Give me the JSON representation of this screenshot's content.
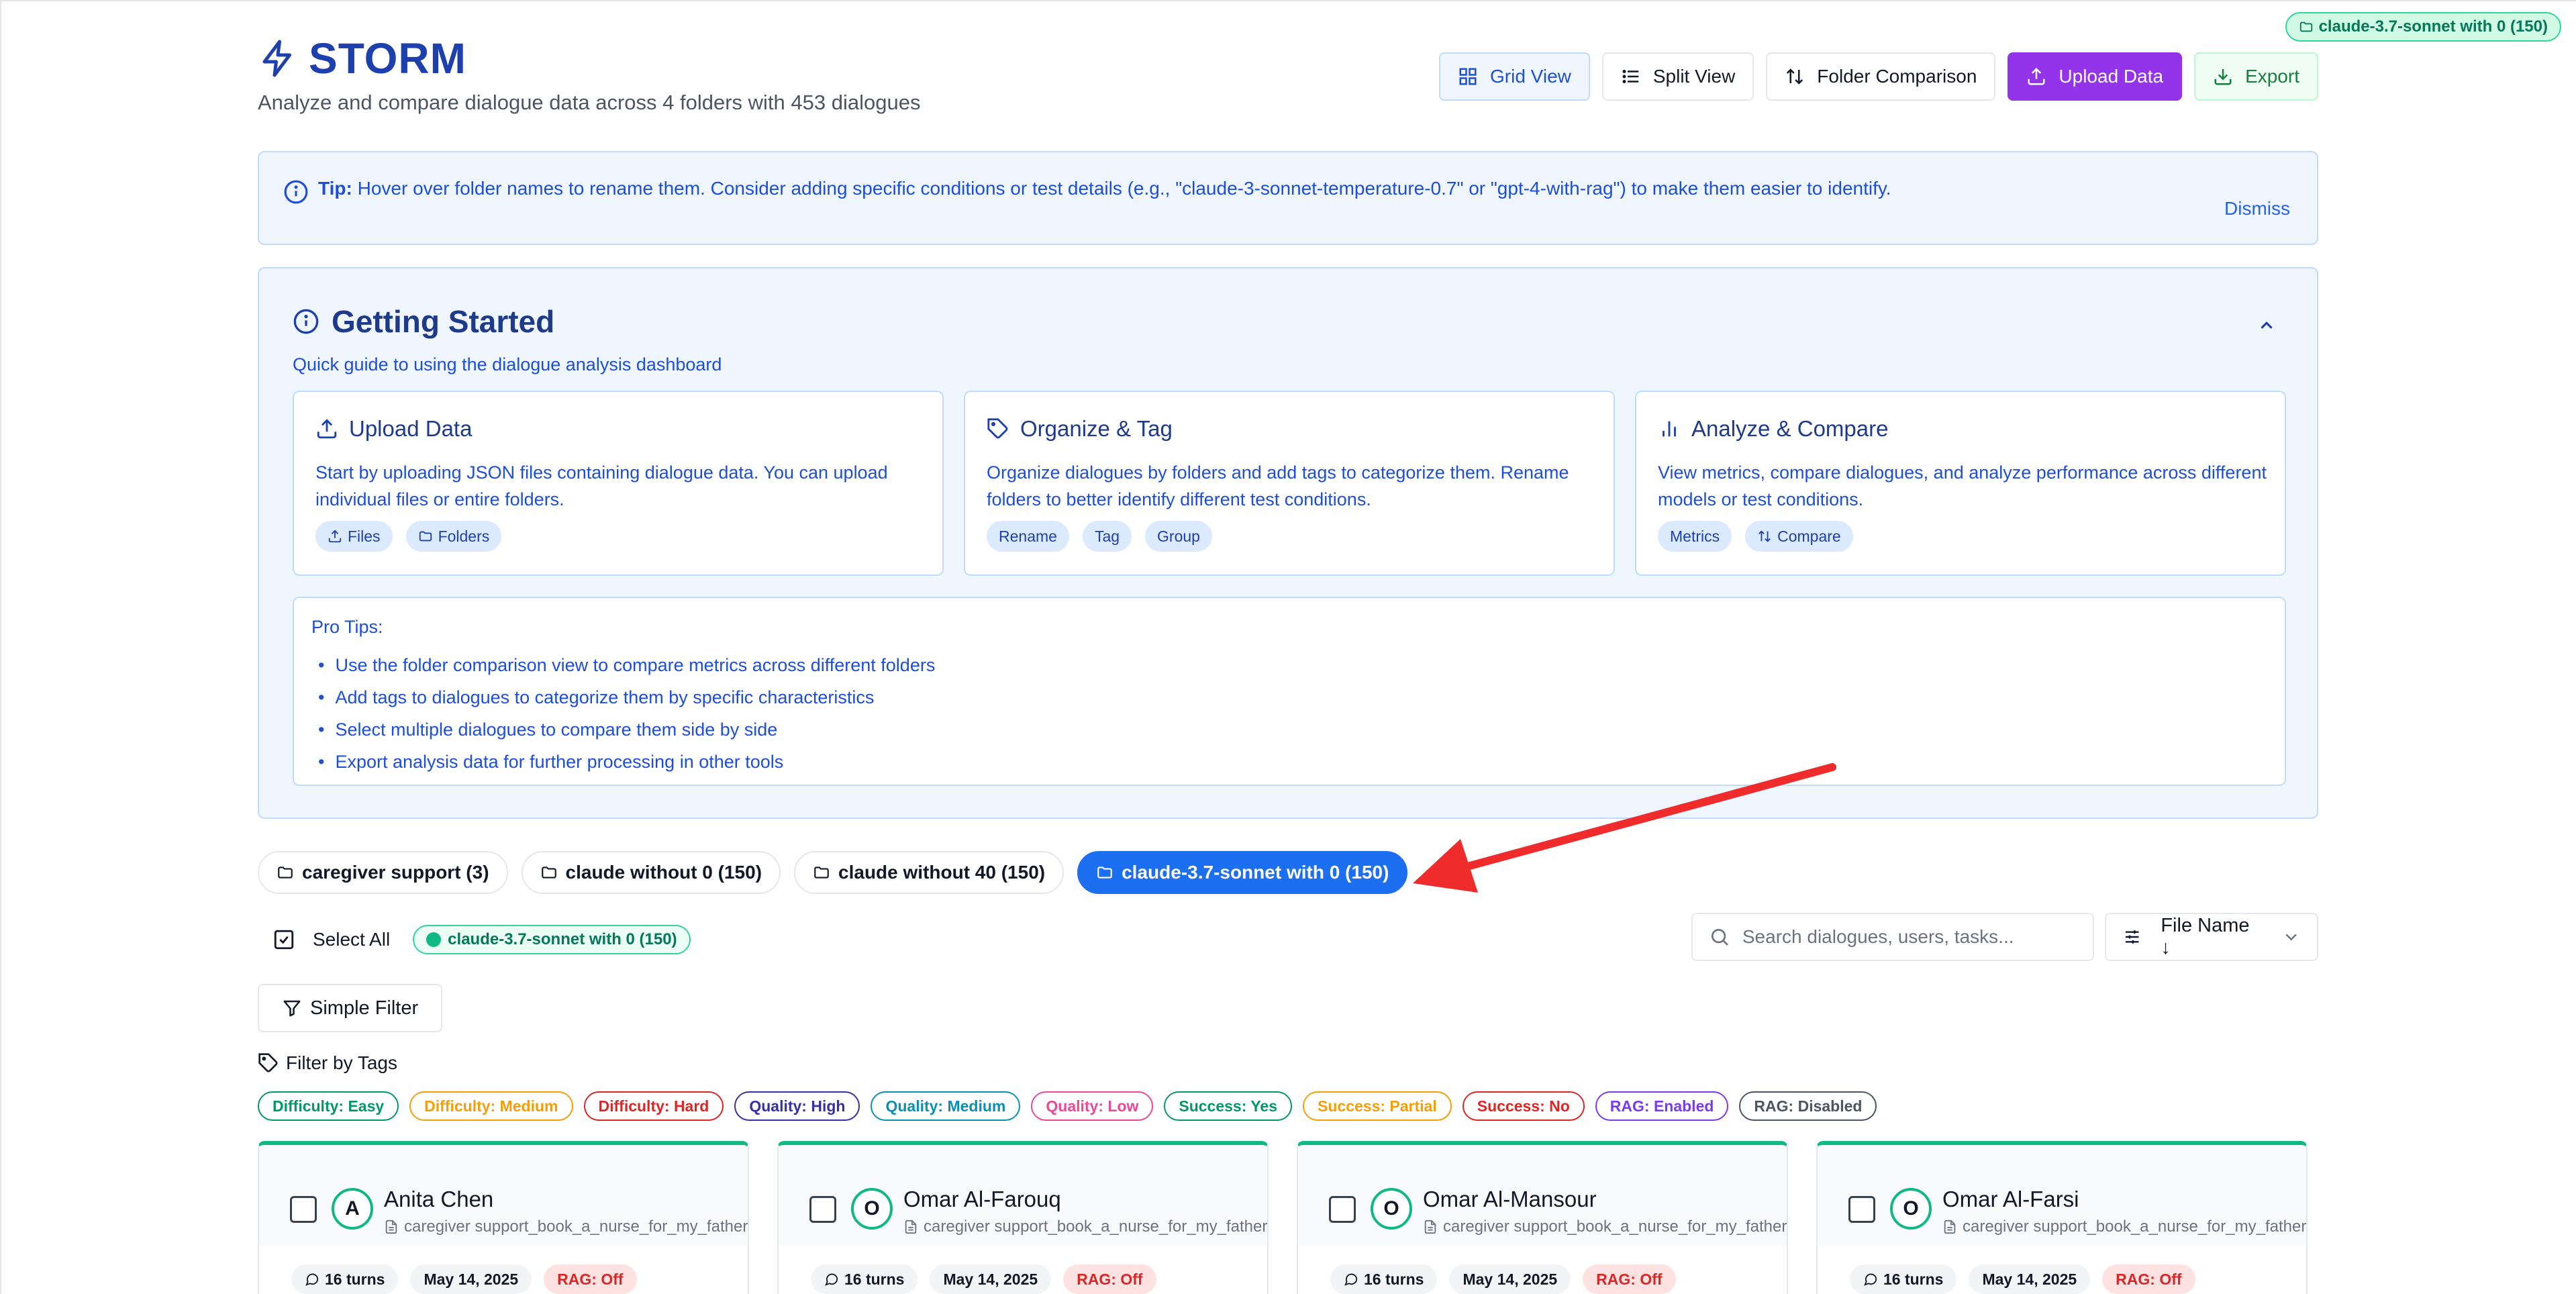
{
  "header": {
    "title": "STORM",
    "subtitle": "Analyze and compare dialogue data across 4 folders with 453 dialogues",
    "top_badge": "claude-3.7-sonnet with 0 (150)"
  },
  "toolbar": {
    "grid_view": "Grid View",
    "split_view": "Split View",
    "folder_comparison": "Folder Comparison",
    "upload_data": "Upload Data",
    "export": "Export"
  },
  "tip": {
    "label": "Tip:",
    "text": "Hover over folder names to rename them. Consider adding specific conditions or test details (e.g., \"claude-3-sonnet-temperature-0.7\" or \"gpt-4-with-rag\") to make them easier to identify.",
    "dismiss": "Dismiss"
  },
  "getting_started": {
    "title": "Getting Started",
    "subtitle": "Quick guide to using the dialogue analysis dashboard",
    "cards": [
      {
        "title": "Upload Data",
        "icon": "upload-icon",
        "desc": "Start by uploading JSON files containing dialogue data. You can upload individual files or entire folders.",
        "chips": [
          "Files",
          "Folders"
        ]
      },
      {
        "title": "Organize & Tag",
        "icon": "tag-icon",
        "desc": "Organize dialogues by folders and add tags to categorize them. Rename folders to better identify different test conditions.",
        "chips": [
          "Rename",
          "Tag",
          "Group"
        ]
      },
      {
        "title": "Analyze & Compare",
        "icon": "bar-chart-icon",
        "desc": "View metrics, compare dialogues, and analyze performance across different models or test conditions.",
        "chips": [
          "Metrics",
          "Compare"
        ]
      }
    ],
    "pro_tips_title": "Pro Tips:",
    "pro_tips": [
      "Use the folder comparison view to compare metrics across different folders",
      "Add tags to dialogues to categorize them by specific characteristics",
      "Select multiple dialogues to compare them side by side",
      "Export analysis data for further processing in other tools"
    ]
  },
  "folders": [
    {
      "label": "caregiver support (3)",
      "active": false
    },
    {
      "label": "claude without 0 (150)",
      "active": false
    },
    {
      "label": "claude without 40 (150)",
      "active": false
    },
    {
      "label": "claude-3.7-sonnet with 0 (150)",
      "active": true
    }
  ],
  "selection": {
    "select_all": "Select All",
    "selected_badge": "claude-3.7-sonnet with 0 (150)"
  },
  "search": {
    "placeholder": "Search dialogues, users, tasks...",
    "value": ""
  },
  "sort": {
    "label": "File Name ↓"
  },
  "filter": {
    "simple_filter": "Simple Filter",
    "tags_title": "Filter by Tags",
    "tags": [
      {
        "label": "Difficulty: Easy",
        "color": "#059669"
      },
      {
        "label": "Difficulty: Medium",
        "color": "#f59e0b"
      },
      {
        "label": "Difficulty: Hard",
        "color": "#dc2626"
      },
      {
        "label": "Quality: High",
        "color": "#3730a3"
      },
      {
        "label": "Quality: Medium",
        "color": "#0891b2"
      },
      {
        "label": "Quality: Low",
        "color": "#ec4899"
      },
      {
        "label": "Success: Yes",
        "color": "#059669"
      },
      {
        "label": "Success: Partial",
        "color": "#f59e0b"
      },
      {
        "label": "Success: No",
        "color": "#dc2626"
      },
      {
        "label": "RAG: Enabled",
        "color": "#7c3aed"
      },
      {
        "label": "RAG: Disabled",
        "color": "#4b5563"
      }
    ]
  },
  "dialogues": [
    {
      "initial": "A",
      "name": "Anita Chen",
      "file": "caregiver support_book_a_nurse_for_my_father",
      "turns": "16 turns",
      "date": "May 14, 2025",
      "rag": "RAG: Off"
    },
    {
      "initial": "O",
      "name": "Omar Al-Farouq",
      "file": "caregiver support_book_a_nurse_for_my_father",
      "turns": "16 turns",
      "date": "May 14, 2025",
      "rag": "RAG: Off"
    },
    {
      "initial": "O",
      "name": "Omar Al-Mansour",
      "file": "caregiver support_book_a_nurse_for_my_father",
      "turns": "16 turns",
      "date": "May 14, 2025",
      "rag": "RAG: Off"
    },
    {
      "initial": "O",
      "name": "Omar Al-Farsi",
      "file": "caregiver support_book_a_nurse_for_my_father",
      "turns": "16 turns",
      "date": "May 14, 2025",
      "rag": "RAG: Off"
    }
  ],
  "colors": {
    "brand": "#1e40af",
    "accent_purple": "#9333ea",
    "active_folder": "#1d6ff2",
    "success": "#10b981",
    "annotation_arrow": "#ef2b2b"
  }
}
